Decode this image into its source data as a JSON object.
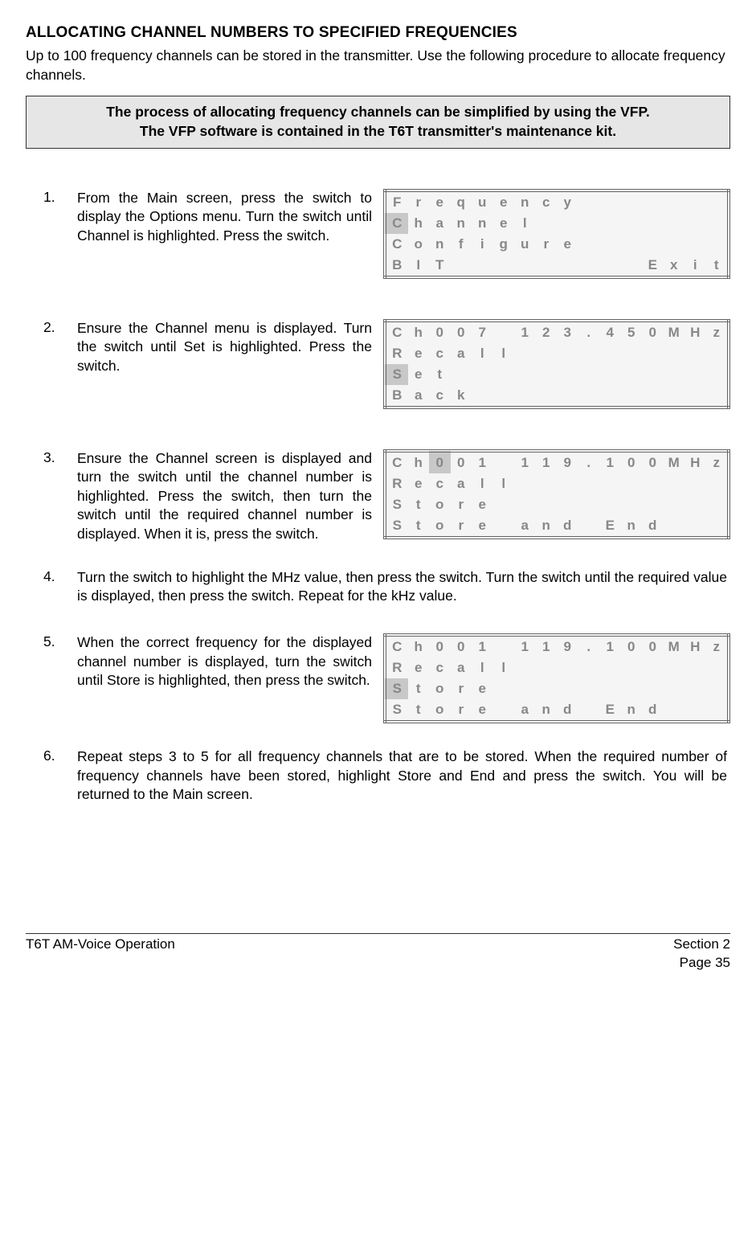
{
  "title": "ALLOCATING CHANNEL NUMBERS TO SPECIFIED FREQUENCIES",
  "intro": "Up to 100 frequency channels can be stored in the transmitter. Use the following procedure to allocate frequency channels.",
  "note_line1": "The process of allocating frequency channels can be simplified by using the VFP.",
  "note_line2": "The VFP software is contained in the T6T transmitter's maintenance kit.",
  "steps": {
    "s1": {
      "num": "1.",
      "text": "From the Main screen, press the switch to display the Options menu. Turn the switch until Channel is highlighted. Press the switch."
    },
    "s2": {
      "num": "2.",
      "text": "Ensure the Channel menu is displayed. Turn the switch until Set is highlighted. Press the switch."
    },
    "s3": {
      "num": "3.",
      "text": "Ensure the Channel screen is displayed and turn the switch until the channel number is highlighted. Press the switch, then turn the switch until the required channel number is displayed. When it is, press the switch."
    },
    "s4": {
      "num": "4.",
      "text": "Turn the switch to highlight the MHz value, then press the switch. Turn the switch until the required value is displayed, then press the switch. Repeat for the kHz value."
    },
    "s5": {
      "num": "5.",
      "text": "When the correct frequency for the displayed channel number is displayed, turn the switch until Store is highlighted, then press the switch."
    },
    "s6": {
      "num": "6.",
      "text": "Repeat steps 3 to 5 for all frequency channels that are to be stored. When the required number of frequency channels have been stored, highlight Store and End and press the switch. You will be returned to the Main screen."
    }
  },
  "lcd1": [
    [
      {
        "c": "F"
      },
      {
        "c": "r"
      },
      {
        "c": "e"
      },
      {
        "c": "q"
      },
      {
        "c": "u"
      },
      {
        "c": "e"
      },
      {
        "c": "n"
      },
      {
        "c": "c"
      },
      {
        "c": "y"
      },
      {
        "c": ""
      },
      {
        "c": ""
      },
      {
        "c": ""
      },
      {
        "c": ""
      },
      {
        "c": ""
      },
      {
        "c": ""
      },
      {
        "c": ""
      }
    ],
    [
      {
        "c": "C",
        "hl": true
      },
      {
        "c": "h"
      },
      {
        "c": "a"
      },
      {
        "c": "n"
      },
      {
        "c": "n"
      },
      {
        "c": "e"
      },
      {
        "c": "l"
      },
      {
        "c": ""
      },
      {
        "c": ""
      },
      {
        "c": ""
      },
      {
        "c": ""
      },
      {
        "c": ""
      },
      {
        "c": ""
      },
      {
        "c": ""
      },
      {
        "c": ""
      },
      {
        "c": ""
      }
    ],
    [
      {
        "c": "C"
      },
      {
        "c": "o"
      },
      {
        "c": "n"
      },
      {
        "c": "f"
      },
      {
        "c": "i"
      },
      {
        "c": "g"
      },
      {
        "c": "u"
      },
      {
        "c": "r"
      },
      {
        "c": "e"
      },
      {
        "c": ""
      },
      {
        "c": ""
      },
      {
        "c": ""
      },
      {
        "c": ""
      },
      {
        "c": ""
      },
      {
        "c": ""
      },
      {
        "c": ""
      }
    ],
    [
      {
        "c": "B"
      },
      {
        "c": "I"
      },
      {
        "c": "T"
      },
      {
        "c": ""
      },
      {
        "c": ""
      },
      {
        "c": ""
      },
      {
        "c": ""
      },
      {
        "c": ""
      },
      {
        "c": ""
      },
      {
        "c": ""
      },
      {
        "c": ""
      },
      {
        "c": ""
      },
      {
        "c": "E"
      },
      {
        "c": "x"
      },
      {
        "c": "i"
      },
      {
        "c": "t"
      }
    ]
  ],
  "lcd2": [
    [
      {
        "c": "C"
      },
      {
        "c": "h"
      },
      {
        "c": "0"
      },
      {
        "c": "0"
      },
      {
        "c": "7"
      },
      {
        "c": ""
      },
      {
        "c": "1"
      },
      {
        "c": "2"
      },
      {
        "c": "3"
      },
      {
        "c": "."
      },
      {
        "c": "4"
      },
      {
        "c": "5"
      },
      {
        "c": "0"
      },
      {
        "c": "M"
      },
      {
        "c": "H"
      },
      {
        "c": "z"
      }
    ],
    [
      {
        "c": "R"
      },
      {
        "c": "e"
      },
      {
        "c": "c"
      },
      {
        "c": "a"
      },
      {
        "c": "l"
      },
      {
        "c": "l"
      },
      {
        "c": ""
      },
      {
        "c": ""
      },
      {
        "c": ""
      },
      {
        "c": ""
      },
      {
        "c": ""
      },
      {
        "c": ""
      },
      {
        "c": ""
      },
      {
        "c": ""
      },
      {
        "c": ""
      },
      {
        "c": ""
      }
    ],
    [
      {
        "c": "S",
        "hl": true
      },
      {
        "c": "e"
      },
      {
        "c": "t"
      },
      {
        "c": ""
      },
      {
        "c": ""
      },
      {
        "c": ""
      },
      {
        "c": ""
      },
      {
        "c": ""
      },
      {
        "c": ""
      },
      {
        "c": ""
      },
      {
        "c": ""
      },
      {
        "c": ""
      },
      {
        "c": ""
      },
      {
        "c": ""
      },
      {
        "c": ""
      },
      {
        "c": ""
      }
    ],
    [
      {
        "c": "B"
      },
      {
        "c": "a"
      },
      {
        "c": "c"
      },
      {
        "c": "k"
      },
      {
        "c": ""
      },
      {
        "c": ""
      },
      {
        "c": ""
      },
      {
        "c": ""
      },
      {
        "c": ""
      },
      {
        "c": ""
      },
      {
        "c": ""
      },
      {
        "c": ""
      },
      {
        "c": ""
      },
      {
        "c": ""
      },
      {
        "c": ""
      },
      {
        "c": ""
      }
    ]
  ],
  "lcd3": [
    [
      {
        "c": "C"
      },
      {
        "c": "h"
      },
      {
        "c": "0",
        "hl": true
      },
      {
        "c": "0"
      },
      {
        "c": "1"
      },
      {
        "c": ""
      },
      {
        "c": "1"
      },
      {
        "c": "1"
      },
      {
        "c": "9"
      },
      {
        "c": "."
      },
      {
        "c": "1"
      },
      {
        "c": "0"
      },
      {
        "c": "0"
      },
      {
        "c": "M"
      },
      {
        "c": "H"
      },
      {
        "c": "z"
      }
    ],
    [
      {
        "c": "R"
      },
      {
        "c": "e"
      },
      {
        "c": "c"
      },
      {
        "c": "a"
      },
      {
        "c": "l"
      },
      {
        "c": "l"
      },
      {
        "c": ""
      },
      {
        "c": ""
      },
      {
        "c": ""
      },
      {
        "c": ""
      },
      {
        "c": ""
      },
      {
        "c": ""
      },
      {
        "c": ""
      },
      {
        "c": ""
      },
      {
        "c": ""
      },
      {
        "c": ""
      }
    ],
    [
      {
        "c": "S"
      },
      {
        "c": "t"
      },
      {
        "c": "o"
      },
      {
        "c": "r"
      },
      {
        "c": "e"
      },
      {
        "c": ""
      },
      {
        "c": ""
      },
      {
        "c": ""
      },
      {
        "c": ""
      },
      {
        "c": ""
      },
      {
        "c": ""
      },
      {
        "c": ""
      },
      {
        "c": ""
      },
      {
        "c": ""
      },
      {
        "c": ""
      },
      {
        "c": ""
      }
    ],
    [
      {
        "c": "S"
      },
      {
        "c": "t"
      },
      {
        "c": "o"
      },
      {
        "c": "r"
      },
      {
        "c": "e"
      },
      {
        "c": ""
      },
      {
        "c": "a"
      },
      {
        "c": "n"
      },
      {
        "c": "d"
      },
      {
        "c": ""
      },
      {
        "c": "E"
      },
      {
        "c": "n"
      },
      {
        "c": "d"
      },
      {
        "c": ""
      },
      {
        "c": ""
      },
      {
        "c": ""
      }
    ]
  ],
  "lcd5": [
    [
      {
        "c": "C"
      },
      {
        "c": "h"
      },
      {
        "c": "0"
      },
      {
        "c": "0"
      },
      {
        "c": "1"
      },
      {
        "c": ""
      },
      {
        "c": "1"
      },
      {
        "c": "1"
      },
      {
        "c": "9"
      },
      {
        "c": "."
      },
      {
        "c": "1"
      },
      {
        "c": "0"
      },
      {
        "c": "0"
      },
      {
        "c": "M"
      },
      {
        "c": "H"
      },
      {
        "c": "z"
      }
    ],
    [
      {
        "c": "R"
      },
      {
        "c": "e"
      },
      {
        "c": "c"
      },
      {
        "c": "a"
      },
      {
        "c": "l"
      },
      {
        "c": "l"
      },
      {
        "c": ""
      },
      {
        "c": ""
      },
      {
        "c": ""
      },
      {
        "c": ""
      },
      {
        "c": ""
      },
      {
        "c": ""
      },
      {
        "c": ""
      },
      {
        "c": ""
      },
      {
        "c": ""
      },
      {
        "c": ""
      }
    ],
    [
      {
        "c": "S",
        "hl": true
      },
      {
        "c": "t"
      },
      {
        "c": "o"
      },
      {
        "c": "r"
      },
      {
        "c": "e"
      },
      {
        "c": ""
      },
      {
        "c": ""
      },
      {
        "c": ""
      },
      {
        "c": ""
      },
      {
        "c": ""
      },
      {
        "c": ""
      },
      {
        "c": ""
      },
      {
        "c": ""
      },
      {
        "c": ""
      },
      {
        "c": ""
      },
      {
        "c": ""
      }
    ],
    [
      {
        "c": "S"
      },
      {
        "c": "t"
      },
      {
        "c": "o"
      },
      {
        "c": "r"
      },
      {
        "c": "e"
      },
      {
        "c": ""
      },
      {
        "c": "a"
      },
      {
        "c": "n"
      },
      {
        "c": "d"
      },
      {
        "c": ""
      },
      {
        "c": "E"
      },
      {
        "c": "n"
      },
      {
        "c": "d"
      },
      {
        "c": ""
      },
      {
        "c": ""
      },
      {
        "c": ""
      }
    ]
  ],
  "footer": {
    "left": "T6T AM-Voice Operation",
    "right1": "Section 2",
    "right2": "Page 35"
  }
}
